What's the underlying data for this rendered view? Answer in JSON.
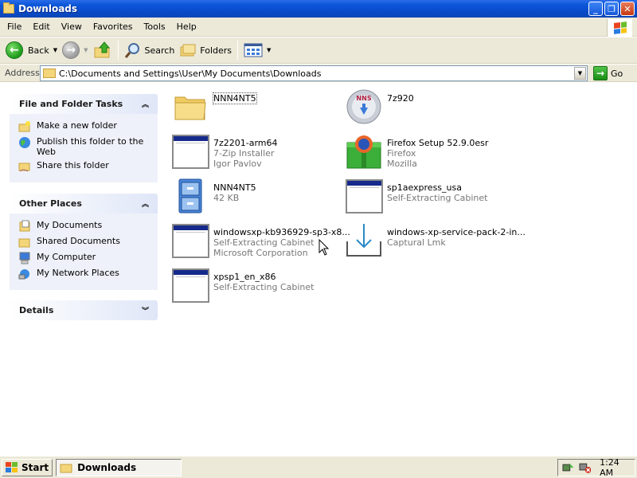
{
  "window": {
    "title": "Downloads"
  },
  "menubar": {
    "items": [
      "File",
      "Edit",
      "View",
      "Favorites",
      "Tools",
      "Help"
    ]
  },
  "toolbar": {
    "back_label": "Back",
    "search_label": "Search",
    "folders_label": "Folders"
  },
  "address": {
    "label": "Address",
    "path": "C:\\Documents and Settings\\User\\My Documents\\Downloads",
    "go_label": "Go"
  },
  "left_panel": {
    "file_tasks": {
      "title": "File and Folder Tasks",
      "items": [
        "Make a new folder",
        "Publish this folder to the Web",
        "Share this folder"
      ]
    },
    "other_places": {
      "title": "Other Places",
      "items": [
        "My Documents",
        "Shared Documents",
        "My Computer",
        "My Network Places"
      ]
    },
    "details": {
      "title": "Details"
    }
  },
  "files": [
    {
      "name": "NNN4NT5",
      "line2": "",
      "line3": "",
      "icon": "folder-icon"
    },
    {
      "name": "7z920",
      "line2": "",
      "line3": "",
      "icon": "nns-cd-icon"
    },
    {
      "name": "7z2201-arm64",
      "line2": "7-Zip Installer",
      "line3": "Igor Pavlov",
      "icon": "executable-icon"
    },
    {
      "name": "Firefox Setup 52.9.0esr",
      "line2": "Firefox",
      "line3": "Mozilla",
      "icon": "firefox-installer-icon"
    },
    {
      "name": "NNN4NT5",
      "line2": "42 KB",
      "line3": "",
      "icon": "file-cabinet-icon"
    },
    {
      "name": "sp1aexpress_usa",
      "line2": "Self-Extracting Cabinet",
      "line3": "",
      "icon": "executable-icon"
    },
    {
      "name": "windowsxp-kb936929-sp3-x8...",
      "line2": "Self-Extracting Cabinet",
      "line3": "Microsoft Corporation",
      "icon": "executable-icon"
    },
    {
      "name": "windows-xp-service-pack-2-in...",
      "line2": "Captural Lmk",
      "line3": "",
      "icon": "download-tray-icon"
    },
    {
      "name": "xpsp1_en_x86",
      "line2": "Self-Extracting Cabinet",
      "line3": "",
      "icon": "executable-icon"
    }
  ],
  "taskbar": {
    "start_label": "Start",
    "task_label": "Downloads",
    "clock": "1:24 AM"
  },
  "colors": {
    "titlebar": "#0a4ac8",
    "chrome": "#ece9d8",
    "task_panel": "#eef1f9"
  }
}
